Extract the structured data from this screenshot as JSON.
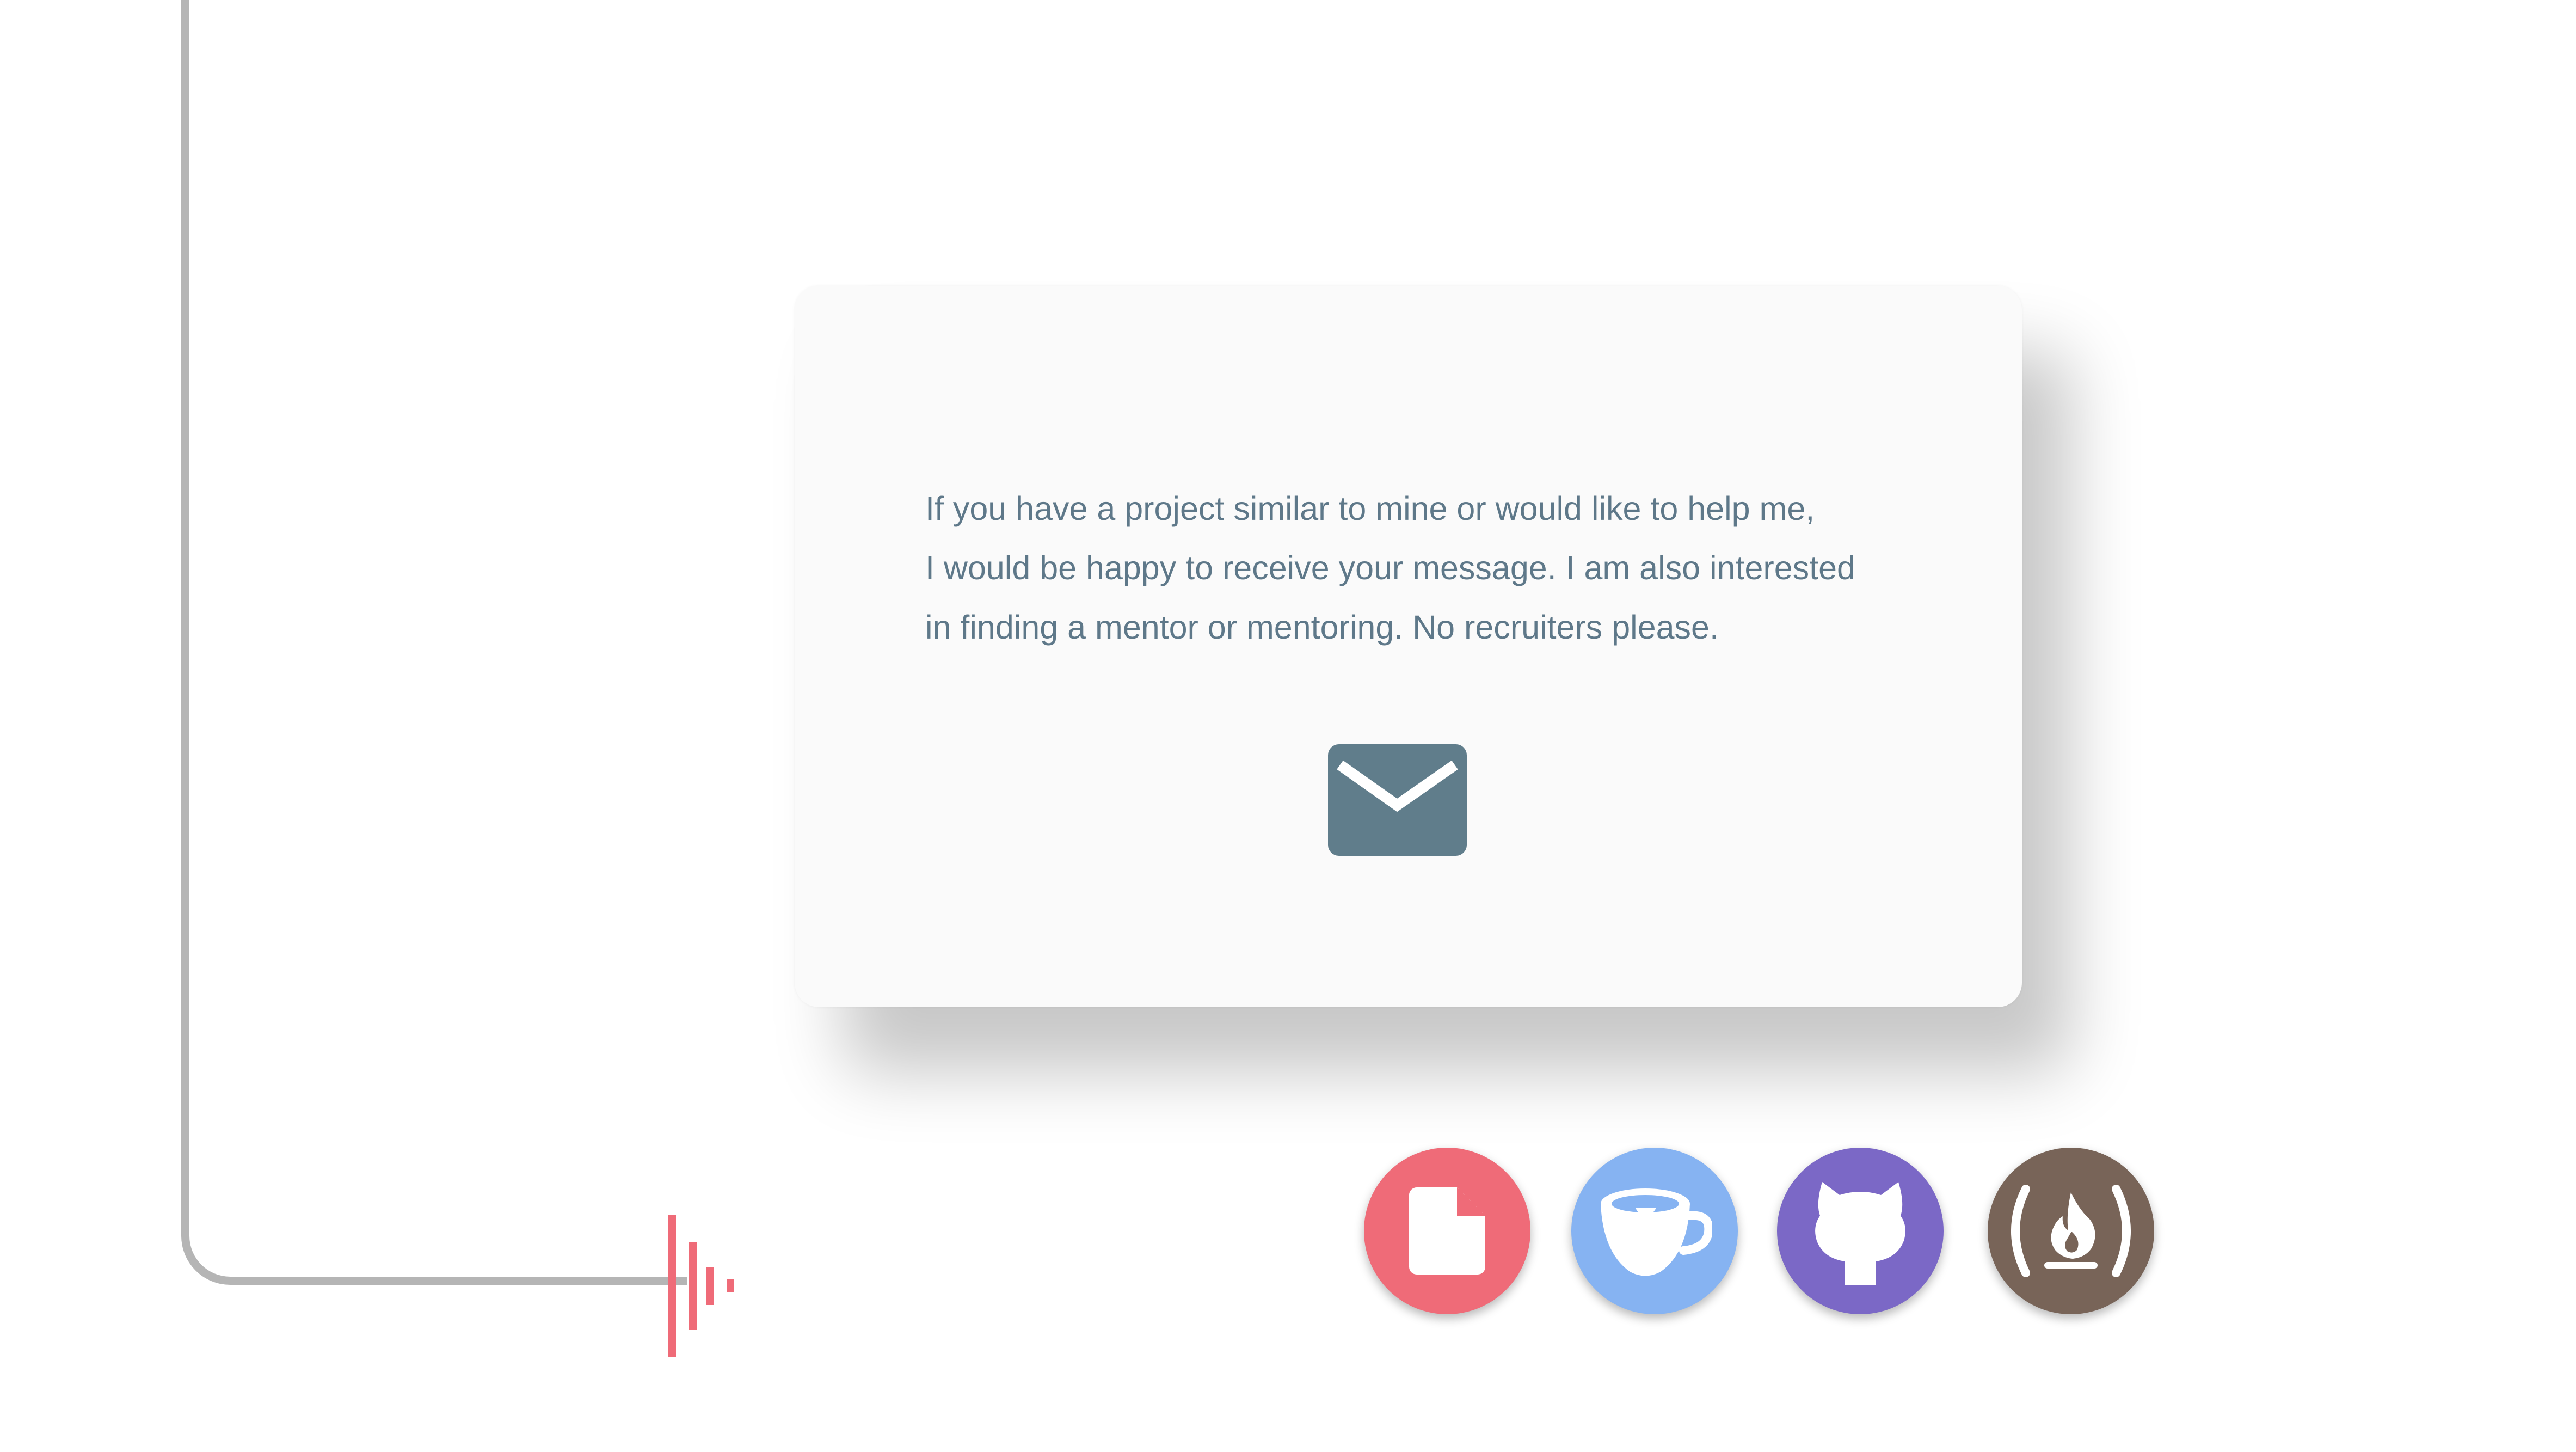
{
  "contact": {
    "message": "If you have a project similar to mine or would like to help me,\nI would be happy to receive your message.  I am also interested\nin finding a mentor or mentoring.  No recruiters please.",
    "mail_icon": "envelope-icon",
    "mail_color": "#607d8b"
  },
  "links": [
    {
      "icon": "resume-document-icon",
      "color": "#ef6b78"
    },
    {
      "icon": "coffee-cup-icon",
      "color": "#86b3f2"
    },
    {
      "icon": "github-octocat-icon",
      "color": "#7b68c6"
    },
    {
      "icon": "freecodecamp-icon",
      "color": "#786458"
    }
  ],
  "colors": {
    "connector": "#b5b5b5",
    "signal": "#ef6b78",
    "card_background": "#fafafa"
  }
}
